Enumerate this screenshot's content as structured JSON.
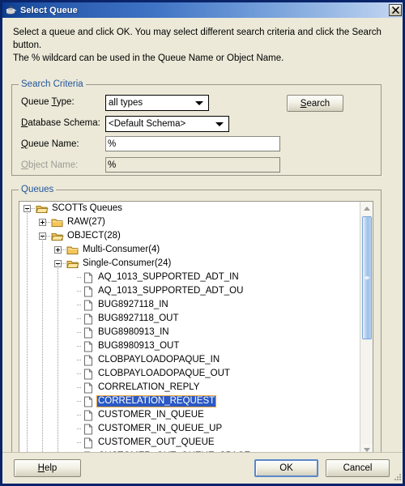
{
  "window": {
    "title": "Select Queue",
    "icon": "java-coffee-cup-icon",
    "close_label": "✕"
  },
  "intro": {
    "line1": "Select a queue and click OK. You may select different search criteria and click the Search button.",
    "line2": "The % wildcard can be used in the Queue Name or Object Name."
  },
  "search_criteria": {
    "legend": "Search Criteria",
    "queue_type": {
      "label_pre": "Queue ",
      "label_mn": "T",
      "label_post": "ype:",
      "value": "all types",
      "options": [
        "all types"
      ]
    },
    "database_schema": {
      "label_mn": "D",
      "label_post": "atabase Schema:",
      "value": "<Default Schema>",
      "options": [
        "<Default Schema>"
      ]
    },
    "queue_name": {
      "label_pre": "",
      "label_mn": "Q",
      "label_post": "ueue Name:",
      "value": "%",
      "placeholder": ""
    },
    "object_name": {
      "label_mn": "O",
      "label_post": "bject Name:",
      "value": "%",
      "placeholder": "",
      "disabled": true
    },
    "search_button": {
      "label_mn": "S",
      "label_post": "earch"
    }
  },
  "queues": {
    "legend": "Queues",
    "selected": "CORRELATION_REQUEST",
    "tree": [
      {
        "label": "SCOTTs Queues",
        "depth": 0,
        "type": "folder-open",
        "state": "expanded"
      },
      {
        "label": "RAW(27)",
        "depth": 1,
        "type": "folder-closed",
        "state": "collapsed"
      },
      {
        "label": "OBJECT(28)",
        "depth": 1,
        "type": "folder-open",
        "state": "expanded"
      },
      {
        "label": "Multi-Consumer(4)",
        "depth": 2,
        "type": "folder-closed",
        "state": "collapsed"
      },
      {
        "label": "Single-Consumer(24)",
        "depth": 2,
        "type": "folder-open",
        "state": "expanded"
      },
      {
        "label": "AQ_1013_SUPPORTED_ADT_IN",
        "depth": 3,
        "type": "leaf",
        "state": "leaf"
      },
      {
        "label": "AQ_1013_SUPPORTED_ADT_OU",
        "depth": 3,
        "type": "leaf",
        "state": "leaf"
      },
      {
        "label": "BUG8927118_IN",
        "depth": 3,
        "type": "leaf",
        "state": "leaf"
      },
      {
        "label": "BUG8927118_OUT",
        "depth": 3,
        "type": "leaf",
        "state": "leaf"
      },
      {
        "label": "BUG8980913_IN",
        "depth": 3,
        "type": "leaf",
        "state": "leaf"
      },
      {
        "label": "BUG8980913_OUT",
        "depth": 3,
        "type": "leaf",
        "state": "leaf"
      },
      {
        "label": "CLOBPAYLOADOPAQUE_IN",
        "depth": 3,
        "type": "leaf",
        "state": "leaf"
      },
      {
        "label": "CLOBPAYLOADOPAQUE_OUT",
        "depth": 3,
        "type": "leaf",
        "state": "leaf"
      },
      {
        "label": "CORRELATION_REPLY",
        "depth": 3,
        "type": "leaf",
        "state": "leaf"
      },
      {
        "label": "CORRELATION_REQUEST",
        "depth": 3,
        "type": "leaf",
        "state": "leaf",
        "selected": true
      },
      {
        "label": "CUSTOMER_IN_QUEUE",
        "depth": 3,
        "type": "leaf",
        "state": "leaf"
      },
      {
        "label": "CUSTOMER_IN_QUEUE_UP",
        "depth": 3,
        "type": "leaf",
        "state": "leaf"
      },
      {
        "label": "CUSTOMER_OUT_QUEUE",
        "depth": 3,
        "type": "leaf",
        "state": "leaf"
      },
      {
        "label": "CUSTOMER_OUT_QUEUE_SPACE",
        "depth": 3,
        "type": "leaf",
        "state": "leaf"
      }
    ]
  },
  "footer": {
    "help": {
      "label_mn": "H",
      "label_post": "elp"
    },
    "ok": {
      "label": "OK"
    },
    "cancel": {
      "label": "Cancel"
    }
  },
  "colors": {
    "title_dark": "#0b3a8f",
    "title_light": "#c9daf2",
    "selection_blue": "#2b59c3",
    "selection_border": "#e8a33d",
    "legend_text": "#22559b",
    "dialog_bg": "#ece9d8",
    "focus_border": "#5a87c9"
  }
}
